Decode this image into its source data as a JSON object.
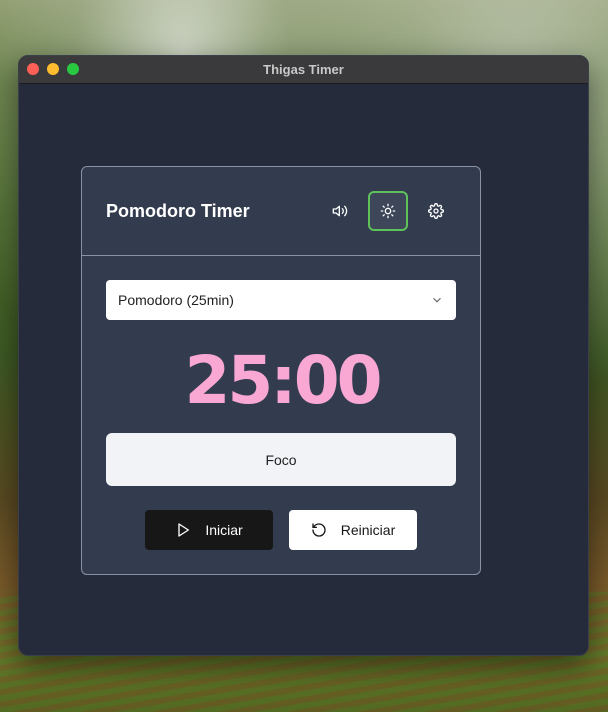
{
  "window": {
    "title": "Thigas Timer"
  },
  "card": {
    "title": "Pomodoro Timer"
  },
  "header_icons": [
    "speaker-icon",
    "sun-icon",
    "gear-icon"
  ],
  "mode_select": {
    "value": "Pomodoro (25min)"
  },
  "timer": {
    "display": "25:00"
  },
  "mode_label": "Foco",
  "actions": {
    "start_label": "Iniciar",
    "reset_label": "Reiniciar"
  },
  "colors": {
    "timer": "#f9a8d4",
    "active_outline": "#5fc15a",
    "card_bg": "#333c4f",
    "window_bg": "#252b3a"
  }
}
